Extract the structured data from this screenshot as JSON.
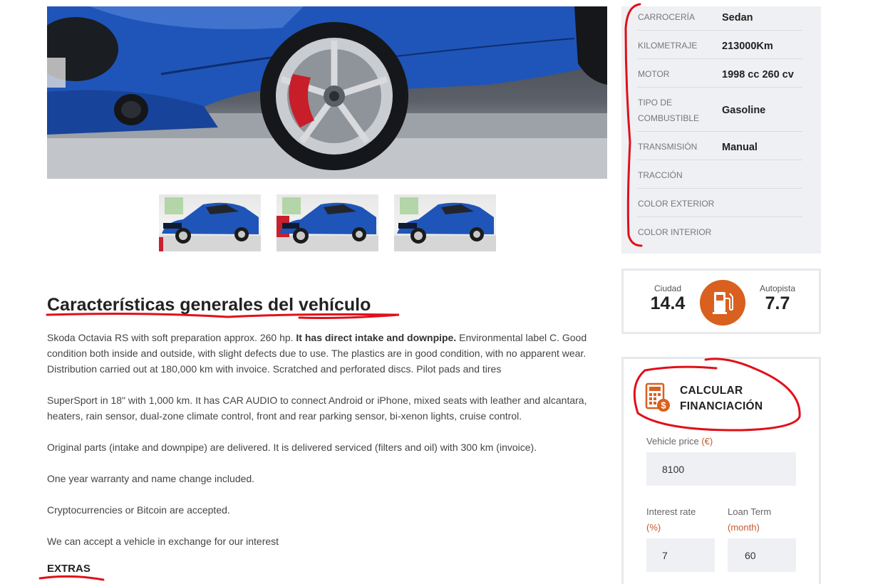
{
  "gallery": {
    "main_photo_alt": "",
    "thumbnail_count": 3
  },
  "specs": [
    {
      "label": "CARROCERÍA",
      "value": "Sedan"
    },
    {
      "label": "KILOMETRAJE",
      "value": "213000Km"
    },
    {
      "label": "MOTOR",
      "value": "1998 cc 260 cv"
    },
    {
      "label_line1": "TIPO DE",
      "label_line2": "COMBUSTIBLE",
      "value": "Gasoline"
    },
    {
      "label": "TRANSMISIÓN",
      "value": "Manual"
    },
    {
      "label": "TRACCIÓN",
      "value": ""
    },
    {
      "label": "COLOR EXTERIOR",
      "value": ""
    },
    {
      "label": "COLOR INTERIOR",
      "value": ""
    }
  ],
  "fuel": {
    "city_label": "Ciudad",
    "city_value": "14.4",
    "highway_label": "Autopista",
    "highway_value": "7.7",
    "icon": "fuel-pump-icon"
  },
  "finance": {
    "title_line1": "CALCULAR",
    "title_line2": "FINANCIACIÓN",
    "icon": "calculator-dollar-icon",
    "price_label": "Vehicle price",
    "price_unit": "(€)",
    "price_value": "8100",
    "rate_label": "Interest rate",
    "rate_unit": "(%)",
    "rate_value": "7",
    "term_label": "Loan Term",
    "term_unit": "(month)",
    "term_value": "60"
  },
  "content": {
    "section_title": "Características generales del vehículo",
    "p1_a": "Skoda Octavia RS with soft preparation approx. 260 hp. ",
    "p1_b": "It has direct intake and downpipe.",
    "p1_c": " Environmental label C. Good condition both inside and outside, with slight defects due to use. The plastics are in good condition, with no apparent wear. Distribution carried out at 180,000 km with invoice. Scratched and perforated discs. Pilot pads and tires",
    "p2": "SuperSport in 18\" with 1,000 km. It has CAR AUDIO to connect Android or iPhone, mixed seats with leather and alcantara, heaters, rain sensor, dual-zone climate control, front and rear parking sensor, bi-xenon lights, cruise control.",
    "p3": "Original parts (intake and downpipe) are delivered. It is delivered serviced (filters and oil) with 300 km (invoice).",
    "p4": "One year warranty and name change included.",
    "p5": "Cryptocurrencies or Bitcoin are accepted.",
    "p6": "We can accept a vehicle in exchange for our interest",
    "extras": "EXTRAS"
  },
  "colors": {
    "accent": "#d9601f",
    "annotation_red": "#e0101a",
    "panel_bg": "#eef0f4",
    "car_blue": "#1f55b8"
  }
}
